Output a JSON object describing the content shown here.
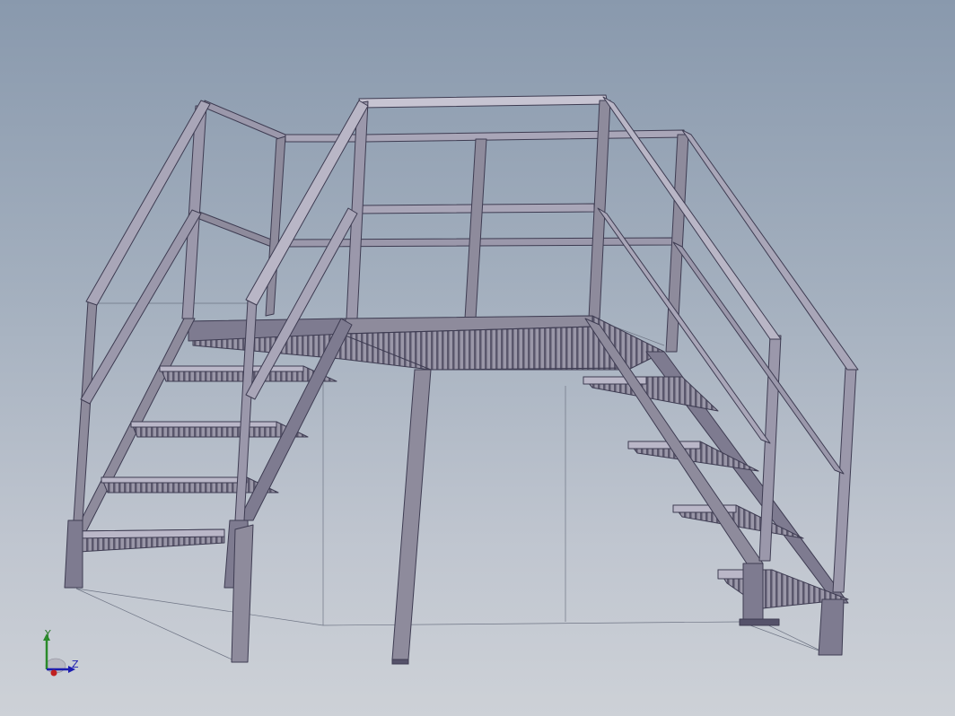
{
  "viewport": {
    "background_top": "#8999ad",
    "background_bottom": "#cdd1d7",
    "model_name": "",
    "steel_color": "#8e8b9c",
    "steel_dark": "#55526a",
    "steel_light": "#b9b6c6",
    "grating_color": "#6d6a7e"
  },
  "triad": {
    "y_label": "Y",
    "z_label": "Z",
    "y_color": "#2a8a2a",
    "z_color": "#1c1cb0",
    "x_color": "#c02020"
  }
}
